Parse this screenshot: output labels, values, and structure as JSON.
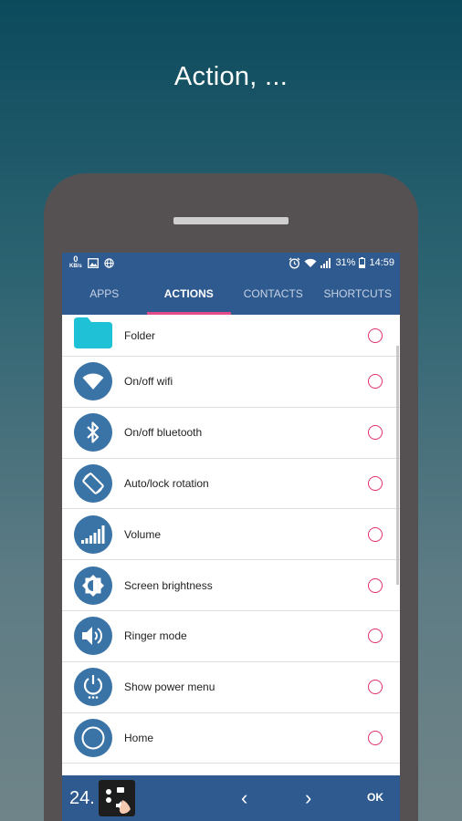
{
  "headline": "Action, ...",
  "status_bar": {
    "speed_value": "0",
    "speed_unit": "KB/s",
    "battery": "31%",
    "time": "14:59"
  },
  "tabs": [
    {
      "label": "APPS",
      "active": false
    },
    {
      "label": "ACTIONS",
      "active": true
    },
    {
      "label": "CONTACTS",
      "active": false
    },
    {
      "label": "SHORTCUTS",
      "active": false
    }
  ],
  "actions": [
    {
      "label": "Folder",
      "icon": "folder-icon"
    },
    {
      "label": "On/off wifi",
      "icon": "wifi-icon"
    },
    {
      "label": "On/off bluetooth",
      "icon": "bluetooth-icon"
    },
    {
      "label": "Auto/lock rotation",
      "icon": "rotation-icon"
    },
    {
      "label": "Volume",
      "icon": "volume-bars-icon"
    },
    {
      "label": "Screen brightness",
      "icon": "brightness-icon"
    },
    {
      "label": "Ringer mode",
      "icon": "speaker-icon"
    },
    {
      "label": "Show power menu",
      "icon": "power-icon"
    },
    {
      "label": "Home",
      "icon": "home-circle-icon"
    }
  ],
  "bottom_bar": {
    "number": "24.",
    "prev_glyph": "‹",
    "next_glyph": "›",
    "ok_label": "OK"
  },
  "colors": {
    "primary": "#2f5a8f",
    "icon_bg": "#3a73a6",
    "accent": "#e0306d",
    "folder": "#1fc1d6"
  }
}
